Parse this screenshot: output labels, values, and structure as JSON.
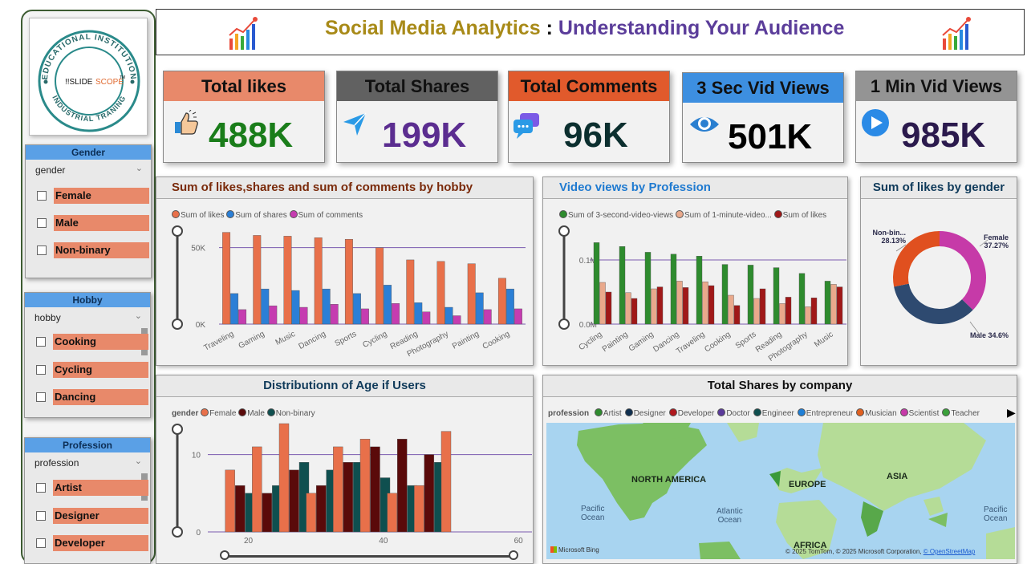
{
  "header": {
    "title_part1": "Social Media Analytics",
    "separator": " : ",
    "title_part2": "Understanding Your Audience"
  },
  "logo": {
    "ring_top": "EDUCATIONAL INSTITUTION",
    "ring_bottom": "INDUSTRIAL TRANING",
    "brand_a": "!!SLIDE",
    "brand_b": "SCOPE",
    "tm": "TM"
  },
  "kpis": [
    {
      "title": "Total likes",
      "value": "488K",
      "header_color": "#e8896a",
      "value_color": "#1a7d1a",
      "icon": "thumbs-up-icon"
    },
    {
      "title": "Total Shares",
      "value": "199K",
      "header_color": "#616161",
      "value_color": "#5b2d90",
      "icon": "send-icon"
    },
    {
      "title": "Total Comments",
      "value": "96K",
      "header_color": "#e15a2c",
      "value_color": "#0c2f2f",
      "icon": "chat-icon"
    },
    {
      "title": "3 Sec Vid Views",
      "value": "501K",
      "header_color": "#3d8fe0",
      "value_color": "#000000",
      "icon": "eye-icon"
    },
    {
      "title": "1 Min Vid Views",
      "value": "985K",
      "header_color": "#949494",
      "value_color": "#2b1a4d",
      "icon": "play-icon"
    }
  ],
  "slicers": {
    "gender": {
      "title": "Gender",
      "field": "gender",
      "items": [
        "Female",
        "Male",
        "Non-binary"
      ]
    },
    "hobby": {
      "title": "Hobby",
      "field": "hobby",
      "items": [
        "Cooking",
        "Cycling",
        "Dancing"
      ]
    },
    "profession": {
      "title": "Profession",
      "field": "profession",
      "items": [
        "Artist",
        "Designer",
        "Developer"
      ]
    }
  },
  "panels": {
    "hobby_chart": "Sum of likes,shares and sum of comments by hobby",
    "views_chart": "Video views by Profession",
    "gender_donut": "Sum of likes by gender",
    "age_chart": "Distributionn of Age if Users",
    "map": "Total Shares by company"
  },
  "map": {
    "legend_title": "profession",
    "legend": [
      {
        "name": "Artist",
        "color": "#2e8b2e"
      },
      {
        "name": "Designer",
        "color": "#0f2f4f"
      },
      {
        "name": "Developer",
        "color": "#b0181e"
      },
      {
        "name": "Doctor",
        "color": "#5a3a9a"
      },
      {
        "name": "Engineer",
        "color": "#0f4f4f"
      },
      {
        "name": "Entrepreneur",
        "color": "#1f7fd6"
      },
      {
        "name": "Musician",
        "color": "#e0601f"
      },
      {
        "name": "Scientist",
        "color": "#c63aa8"
      },
      {
        "name": "Teacher",
        "color": "#3aa03a"
      }
    ],
    "labels": {
      "na": "NORTH AMERICA",
      "eu": "EUROPE",
      "asia": "ASIA",
      "africa": "AFRICA",
      "pac1": "Pacific\nOcean",
      "atl": "Atlantic\nOcean",
      "pac2": "Pacific\nOcean"
    },
    "bing": "Microsoft Bing",
    "copyright": "© 2025 TomTom, © 2025 Microsoft Corporation,",
    "osm": "© OpenStreetMap"
  },
  "chart_data": [
    {
      "type": "bar",
      "title": "Sum of likes,shares and sum of comments by hobby",
      "categories": [
        "Traveling",
        "Gaming",
        "Music",
        "Dancing",
        "Sports",
        "Cycling",
        "Reading",
        "Photography",
        "Painting",
        "Cooking"
      ],
      "series": [
        {
          "name": "Sum of likes",
          "color": "#e8704a",
          "values": [
            60000,
            58000,
            57500,
            56500,
            55500,
            50000,
            42000,
            41000,
            39500,
            30000
          ]
        },
        {
          "name": "Sum of shares",
          "color": "#2b7fd6",
          "values": [
            20000,
            23000,
            22000,
            23000,
            20000,
            25500,
            14000,
            11000,
            20500,
            23000
          ]
        },
        {
          "name": "Sum of comments",
          "color": "#c53cb0",
          "values": [
            9500,
            12000,
            11000,
            13000,
            10000,
            13500,
            8000,
            5500,
            9500,
            10000
          ]
        }
      ],
      "ylim": [
        0,
        75000
      ],
      "ticks": [
        {
          "v": 0,
          "label": "0K"
        },
        {
          "v": 50000,
          "label": "50K"
        }
      ],
      "reference_line": 50000
    },
    {
      "type": "bar",
      "title": "Video views by Profession",
      "categories": [
        "Cycling",
        "Painting",
        "Gaming",
        "Dancing",
        "Traveling",
        "Cooking",
        "Sports",
        "Reading",
        "Photography",
        "Music"
      ],
      "series": [
        {
          "name": "Sum of 3-second-video-views",
          "color": "#2e8b2e",
          "values": [
            0.127,
            0.121,
            0.112,
            0.109,
            0.106,
            0.093,
            0.092,
            0.088,
            0.079,
            0.067
          ]
        },
        {
          "name": "Sum of 1-minute-video...",
          "color": "#e9a98c",
          "values": [
            0.065,
            0.049,
            0.055,
            0.067,
            0.066,
            0.045,
            0.04,
            0.032,
            0.027,
            0.062
          ]
        },
        {
          "name": "Sum of likes",
          "color": "#a01818",
          "values": [
            0.05,
            0.04,
            0.058,
            0.057,
            0.06,
            0.029,
            0.055,
            0.042,
            0.041,
            0.058
          ]
        }
      ],
      "ylim": [
        0,
        0.16
      ],
      "ticks": [
        {
          "v": 0,
          "label": "0.0M"
        },
        {
          "v": 0.1,
          "label": "0.1M"
        }
      ],
      "reference_line": 0.1
    },
    {
      "type": "pie",
      "title": "Sum of likes by gender",
      "slices": [
        {
          "name": "Female",
          "value": 37.27,
          "label": "37.27%",
          "color": "#c63aa8"
        },
        {
          "name": "Male",
          "value": 34.6,
          "label": "34.6%",
          "color": "#2e4a70"
        },
        {
          "name": "Non-bin...",
          "value": 28.13,
          "label": "28.13%",
          "color": "#e0501f"
        }
      ]
    },
    {
      "type": "bar",
      "title": "Distributionn of Age if Users",
      "legend_title": "gender",
      "x": [
        18,
        22,
        26,
        30,
        34,
        38,
        42,
        46,
        50,
        54,
        58
      ],
      "series": [
        {
          "name": "Female",
          "color": "#e8704a",
          "values": [
            8,
            11,
            14,
            5,
            11,
            12,
            5,
            6,
            13,
            0,
            0
          ]
        },
        {
          "name": "Male",
          "color": "#5a0a0a",
          "values": [
            6,
            5,
            8,
            6,
            9,
            11,
            12,
            10,
            0,
            0,
            0
          ]
        },
        {
          "name": "Non-binary",
          "color": "#0f4f4f",
          "values": [
            5,
            6,
            9,
            8,
            9,
            7,
            6,
            9,
            0,
            0,
            0
          ]
        }
      ],
      "ylim": [
        0,
        14
      ],
      "ticks_y": [
        0,
        10
      ],
      "ticks_x": [
        20,
        40,
        60
      ],
      "reference_line": 10
    }
  ]
}
